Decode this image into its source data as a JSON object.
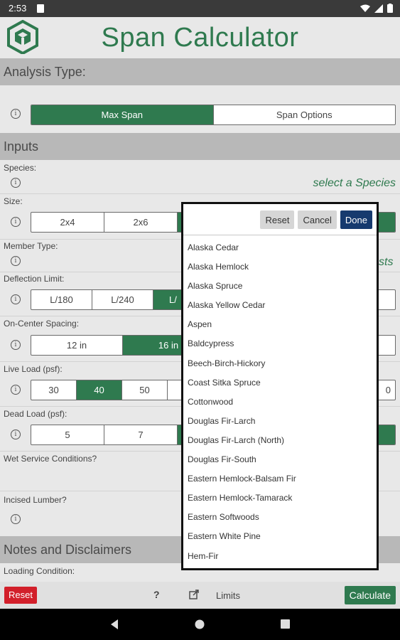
{
  "status_bar": {
    "time": "2:53"
  },
  "app": {
    "title": "Span Calculator"
  },
  "analysis": {
    "header": "Analysis Type:",
    "options": [
      "Max Span",
      "Span Options"
    ]
  },
  "inputs": {
    "header": "Inputs",
    "species_label": "Species:",
    "species_hint": "select a Species",
    "size_label": "Size:",
    "size_options": [
      "2x4",
      "2x6"
    ],
    "member_type_label": "Member Type:",
    "member_type_hint_partial": "sts",
    "deflection_label": "Deflection Limit:",
    "deflection_options": [
      "L/180",
      "L/240",
      "L/"
    ],
    "spacing_label": "On-Center Spacing:",
    "spacing_options": [
      "12 in",
      "16 in"
    ],
    "live_load_label": "Live Load (psf):",
    "live_load_options": [
      "30",
      "40",
      "50",
      "",
      "0"
    ],
    "dead_load_label": "Dead Load (psf):",
    "dead_load_options": [
      "5",
      "7"
    ],
    "wet_label": "Wet Service Conditions?",
    "incised_label": "Incised Lumber?"
  },
  "notes": {
    "header": "Notes and Disclaimers",
    "loading_label": "Loading Condition:"
  },
  "popup": {
    "reset": "Reset",
    "cancel": "Cancel",
    "done": "Done",
    "species": [
      "Alaska Cedar",
      "Alaska Hemlock",
      "Alaska Spruce",
      "Alaska Yellow Cedar",
      "Aspen",
      "Baldcypress",
      "Beech-Birch-Hickory",
      "Coast Sitka Spruce",
      "Cottonwood",
      "Douglas Fir-Larch",
      "Douglas Fir-Larch (North)",
      "Douglas Fir-South",
      "Eastern Hemlock-Balsam Fir",
      "Eastern Hemlock-Tamarack",
      "Eastern Softwoods",
      "Eastern White Pine",
      "Hem-Fir"
    ]
  },
  "toolbar": {
    "reset": "Reset",
    "help": "?",
    "limits": "Limits",
    "calculate": "Calculate"
  },
  "colors": {
    "brand_green": "#2f7a4f",
    "danger_red": "#d21f2a",
    "done_blue": "#163a6e"
  }
}
